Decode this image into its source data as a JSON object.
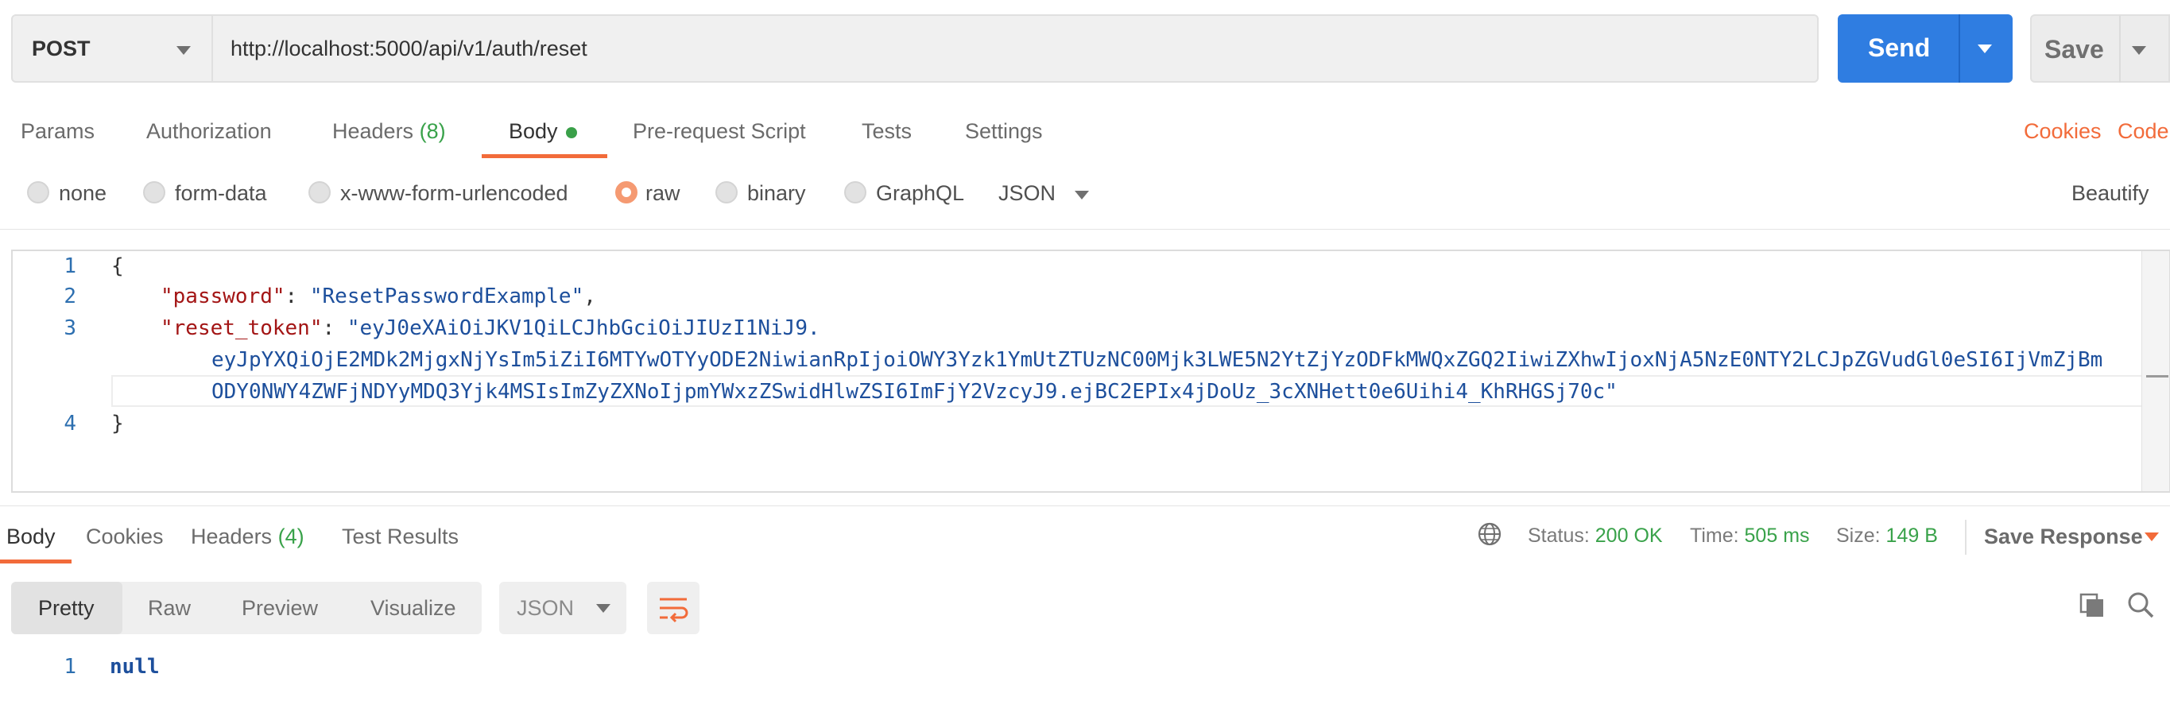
{
  "request": {
    "method": "POST",
    "url": "http://localhost:5000/api/v1/auth/reset",
    "send_label": "Send",
    "save_label": "Save"
  },
  "tabs": [
    {
      "label": "Params"
    },
    {
      "label": "Authorization"
    },
    {
      "label": "Headers",
      "count": "(8)"
    },
    {
      "label": "Body"
    },
    {
      "label": "Pre-request Script"
    },
    {
      "label": "Tests"
    },
    {
      "label": "Settings"
    }
  ],
  "links": {
    "cookies": "Cookies",
    "code": "Code",
    "beautify": "Beautify"
  },
  "body_types": [
    "none",
    "form-data",
    "x-www-form-urlencoded",
    "raw",
    "binary",
    "GraphQL"
  ],
  "body_format": "JSON",
  "editor": {
    "line_numbers": [
      "1",
      "2",
      "3",
      "4"
    ],
    "line1": "{",
    "pw_key": "\"password\"",
    "pw_value": "\"ResetPasswordExample\"",
    "token_key": "\"reset_token\"",
    "token_line1": "\"eyJ0eXAiOiJKV1QiLCJhbGciOiJIUzI1NiJ9.",
    "token_line2": "eyJpYXQiOjE2MDk2MjgxNjYsIm5iZiI6MTYwOTYyODE2NiwianRpIjoiOWY3Yzk1YmUtZTUzNC00Mjk3LWE5N2YtZjYzODFkMWQxZGQ2IiwiZXhwIjoxNjA5NzE0NTY2LCJpZGVudGl0eSI6IjVmZjBm",
    "token_line3": "ODY0NWY4ZWFjNDYyMDQ3Yjk4MSIsImZyZXNoIjpmYWxzZSwidHlwZSI6ImFjY2VzcyJ9.ejBC2EPIx4jDoUz_3cXNHett0e6Uihi4_KhRHGSj70c\"",
    "line4": "}"
  },
  "response": {
    "tabs": [
      {
        "label": "Body"
      },
      {
        "label": "Cookies"
      },
      {
        "label": "Headers",
        "count": "(4)"
      },
      {
        "label": "Test Results"
      }
    ],
    "status_label": "Status:",
    "status_value": "200 OK",
    "time_label": "Time:",
    "time_value": "505 ms",
    "size_label": "Size:",
    "size_value": "149 B",
    "save_response": "Save Response",
    "views": [
      "Pretty",
      "Raw",
      "Preview",
      "Visualize"
    ],
    "format": "JSON",
    "line_number": "1",
    "body": "null"
  }
}
